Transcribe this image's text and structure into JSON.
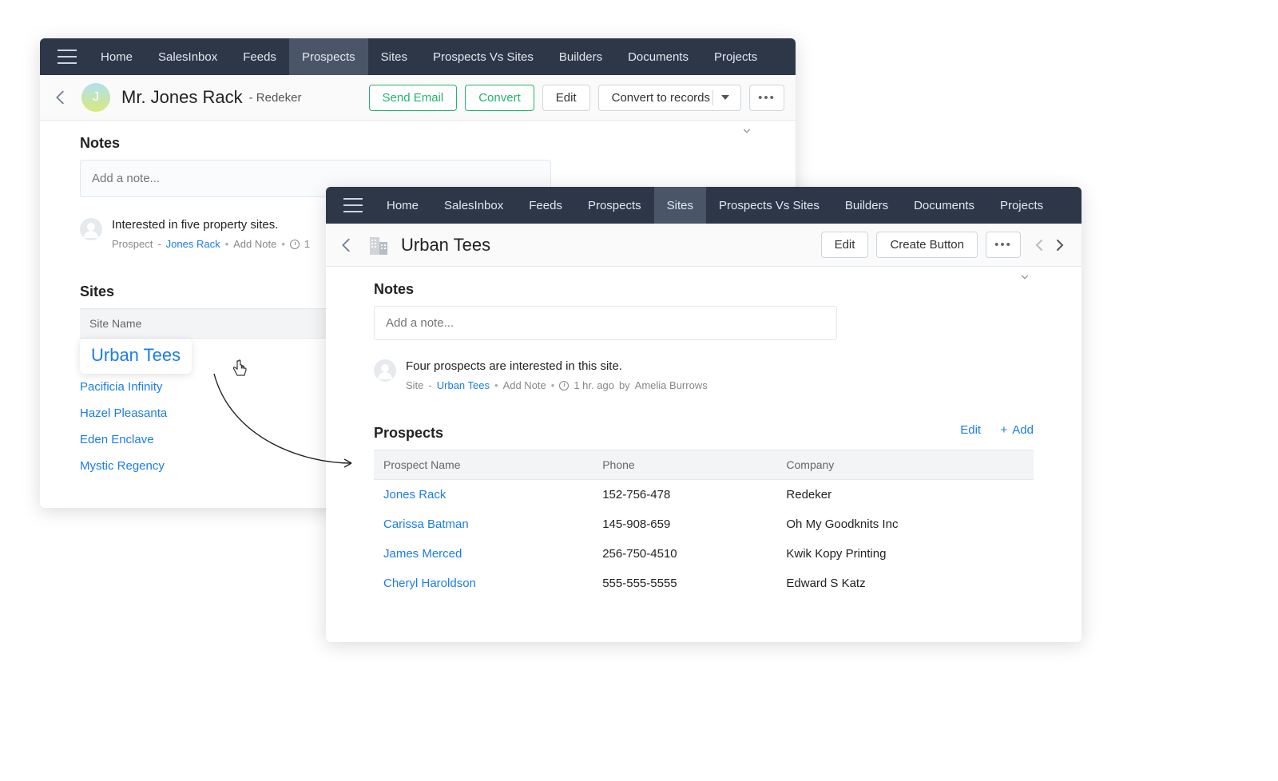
{
  "windowA": {
    "nav": {
      "items": [
        "Home",
        "SalesInbox",
        "Feeds",
        "Prospects",
        "Sites",
        "Prospects Vs Sites",
        "Builders",
        "Documents",
        "Projects"
      ],
      "activeIndex": 3
    },
    "header": {
      "title": "Mr. Jones Rack",
      "subtitle": "- Redeker",
      "avatar_letter": "J",
      "buttons": {
        "send_email": "Send Email",
        "convert": "Convert",
        "edit": "Edit",
        "convert_records": "Convert to records"
      }
    },
    "notes": {
      "heading": "Notes",
      "placeholder": "Add a note...",
      "entry": {
        "text": "Interested in five property sites.",
        "meta_label": "Prospect",
        "meta_link": "Jones Rack",
        "add_note": "Add Note",
        "time": "1"
      }
    },
    "sites": {
      "heading": "Sites",
      "column": "Site Name",
      "items": [
        "Urban Tees",
        "Pacificia Infinity",
        "Hazel Pleasanta",
        "Eden Enclave",
        "Mystic Regency"
      ],
      "activeIndex": 0
    }
  },
  "windowB": {
    "nav": {
      "items": [
        "Home",
        "SalesInbox",
        "Feeds",
        "Prospects",
        "Sites",
        "Prospects Vs Sites",
        "Builders",
        "Documents",
        "Projects"
      ],
      "activeIndex": 4
    },
    "header": {
      "title": "Urban Tees",
      "buttons": {
        "edit": "Edit",
        "create_button": "Create Button"
      }
    },
    "notes": {
      "heading": "Notes",
      "placeholder": "Add a note...",
      "entry": {
        "text": "Four prospects are interested in this site.",
        "meta_label": "Site",
        "meta_link": "Urban Tees",
        "add_note": "Add Note",
        "time": "1 hr. ago",
        "by_label": "by",
        "author": "Amelia Burrows"
      }
    },
    "prospects": {
      "heading": "Prospects",
      "edit": "Edit",
      "add": "Add",
      "columns": [
        "Prospect Name",
        "Phone",
        "Company"
      ],
      "rows": [
        {
          "name": "Jones Rack",
          "phone": "152-756-478",
          "company": "Redeker"
        },
        {
          "name": "Carissa Batman",
          "phone": "145-908-659",
          "company": "Oh My Goodknits Inc"
        },
        {
          "name": "James Merced",
          "phone": "256-750-4510",
          "company": "Kwik Kopy Printing"
        },
        {
          "name": "Cheryl Haroldson",
          "phone": "555-555-5555",
          "company": "Edward S Katz"
        }
      ]
    }
  }
}
